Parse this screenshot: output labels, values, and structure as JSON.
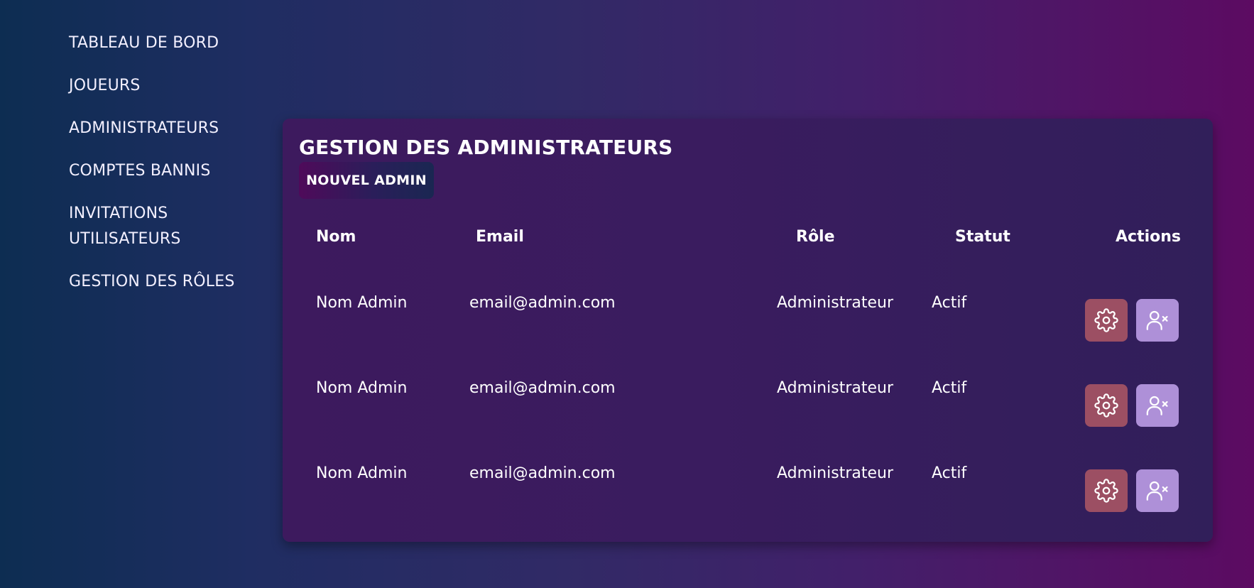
{
  "sidebar": {
    "items": [
      {
        "label": "TABLEAU DE BORD"
      },
      {
        "label": "JOUEURS"
      },
      {
        "label": "ADMINISTRATEURS"
      },
      {
        "label": "COMPTES BANNIS"
      },
      {
        "label": "INVITATIONS UTILISATEURS"
      },
      {
        "label": "GESTION DES RÔLES"
      }
    ]
  },
  "main": {
    "title": "GESTION DES ADMINISTRATEURS",
    "new_admin_label": "NOUVEL ADMIN",
    "table": {
      "headers": {
        "name": "Nom",
        "email": "Email",
        "role": "Rôle",
        "status": "Statut",
        "actions": "Actions"
      },
      "rows": [
        {
          "name": "Nom Admin",
          "email": "email@admin.com",
          "role": "Administrateur",
          "status": "Actif"
        },
        {
          "name": "Nom Admin",
          "email": "email@admin.com",
          "role": "Administrateur",
          "status": "Actif"
        },
        {
          "name": "Nom Admin",
          "email": "email@admin.com",
          "role": "Administrateur",
          "status": "Actif"
        }
      ]
    }
  },
  "icons": {
    "settings": "gear-icon",
    "remove_user": "user-remove-icon"
  },
  "colors": {
    "settings_button": "#9c4f63",
    "remove_button": "#ae90d8",
    "panel_background": "#3a1c5f"
  }
}
